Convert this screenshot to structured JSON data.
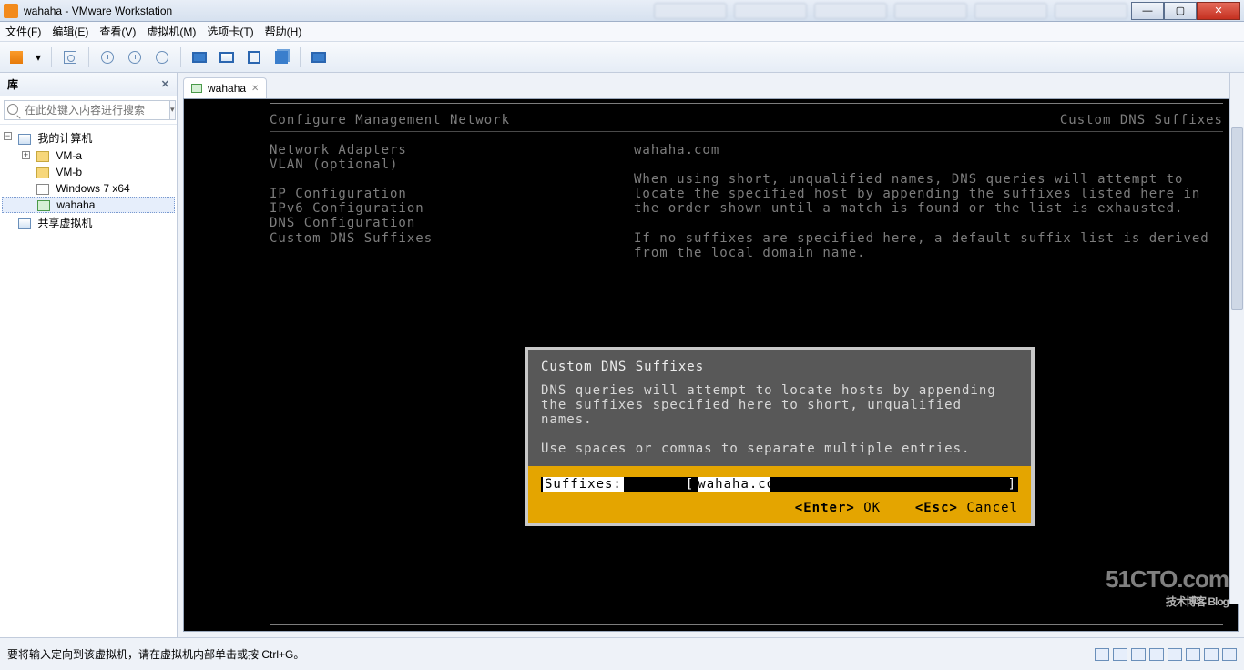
{
  "titlebar": {
    "title": "wahaha - VMware Workstation"
  },
  "menubar": {
    "file": "文件(F)",
    "edit": "编辑(E)",
    "view": "查看(V)",
    "vm": "虚拟机(M)",
    "tabs": "选项卡(T)",
    "help": "帮助(H)"
  },
  "sidebar": {
    "header": "库",
    "search_placeholder": "在此处键入内容进行搜索",
    "tree": {
      "root": "我的计算机",
      "items": [
        "VM-a",
        "VM-b",
        "Windows 7 x64",
        "wahaha"
      ],
      "shared": "共享虚拟机"
    }
  },
  "tab": {
    "label": "wahaha"
  },
  "esxi": {
    "left_title": "Configure Management Network",
    "right_title": "Custom DNS Suffixes",
    "menu": {
      "netadapters": "Network Adapters",
      "vlan": "VLAN (optional)",
      "ipcfg": "IP Configuration",
      "ipv6cfg": "IPv6 Configuration",
      "dnscfg": "DNS Configuration",
      "customdns": "Custom DNS Suffixes"
    },
    "info": {
      "domain": "wahaha.com",
      "p1": "When using short, unqualified names, DNS queries will attempt to locate the specified host by appending the suffixes listed here in the order shown until a match is found or the list is exhausted.",
      "p2": "If no suffixes are specified here, a default suffix list is derived from the local domain name."
    }
  },
  "dialog": {
    "title": "Custom DNS Suffixes",
    "p1": "DNS queries will attempt to locate hosts by appending the suffixes specified here to short, unqualified names.",
    "p2": "Use spaces or commas to separate multiple entries.",
    "field_label": "Suffixes:",
    "field_value": "wahaha.com",
    "ok_key": "<Enter>",
    "ok_label": " OK",
    "cancel_key": "<Esc>",
    "cancel_label": " Cancel"
  },
  "statusbar": {
    "hint": "要将输入定向到该虚拟机，请在虚拟机内部单击或按 Ctrl+G。"
  },
  "watermark": {
    "brand": "51CTO.com",
    "sub": "技术博客  Blog"
  }
}
